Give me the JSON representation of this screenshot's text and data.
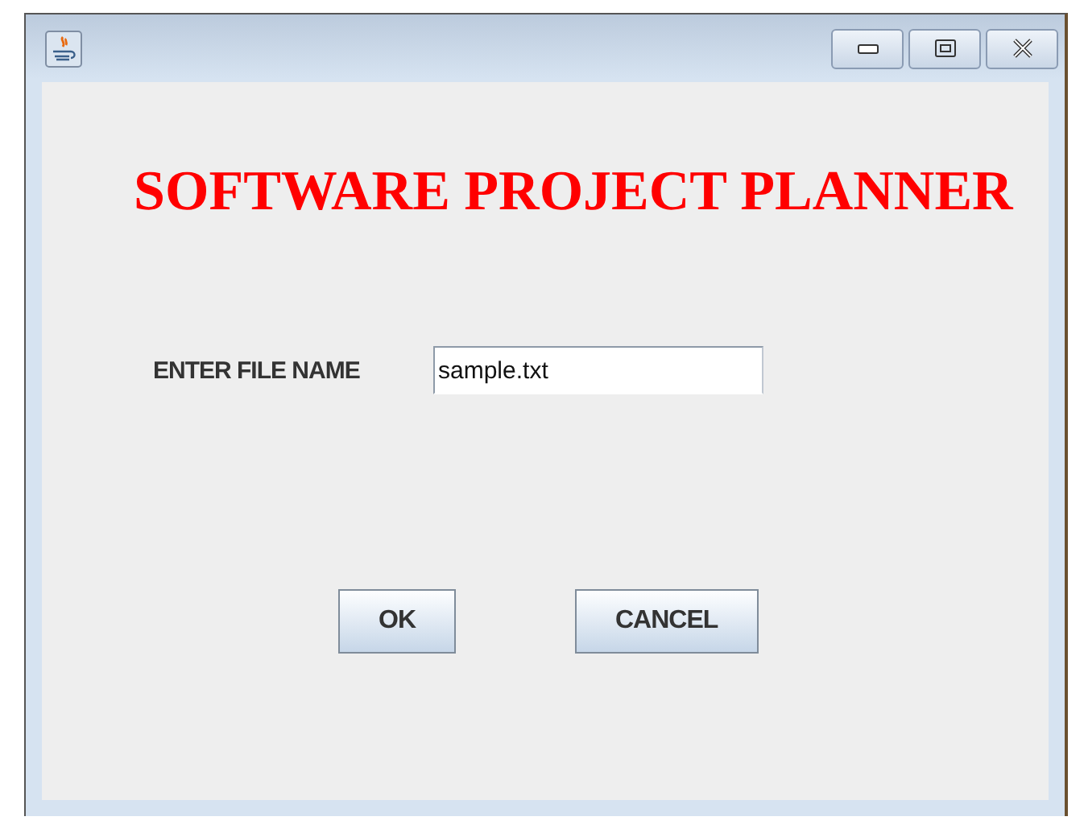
{
  "heading": "SOFTWARE PROJECT PLANNER",
  "file_field": {
    "label": "ENTER FILE NAME",
    "value": "sample.txt"
  },
  "buttons": [
    {
      "label": "OK"
    },
    {
      "label": "CANCEL"
    }
  ]
}
